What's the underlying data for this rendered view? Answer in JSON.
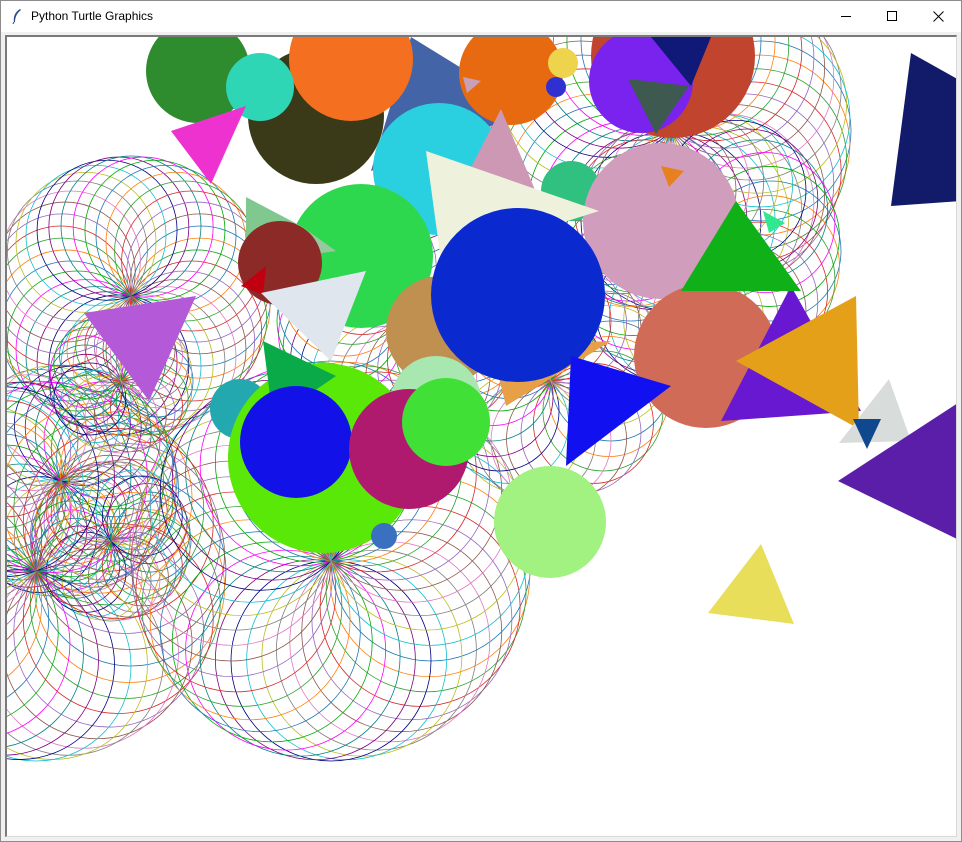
{
  "window": {
    "title": "Python Turtle Graphics",
    "app_icon": "feather-icon",
    "controls": [
      "minimize-icon",
      "maximize-icon",
      "close-icon"
    ]
  },
  "canvas": {
    "background": "#ffffff",
    "spirograph_colors": [
      "#1f77b4",
      "#ff7f0e",
      "#2ca02c",
      "#d62728",
      "#9467bd",
      "#8c564b",
      "#e377c2",
      "#7f7f7f",
      "#bcbd22",
      "#17becf",
      "#000080",
      "#800080",
      "#008080",
      "#ff00ff",
      "#00aa00"
    ],
    "shapes_description_colors": {
      "green_circle": "#2e8b2e",
      "orange_circle": "#f26b21",
      "blue_circle": "#0a2ad0",
      "lime_circle": "#5ae808",
      "crimson_circle": "#b01a6e",
      "light_green_circle": "#a2f282",
      "orange_triangle": "#e4a018",
      "yellow_triangle": "#e8de5a",
      "violet_triangle": "#5a1ea8",
      "navy_triangle": "#121a6a"
    }
  }
}
